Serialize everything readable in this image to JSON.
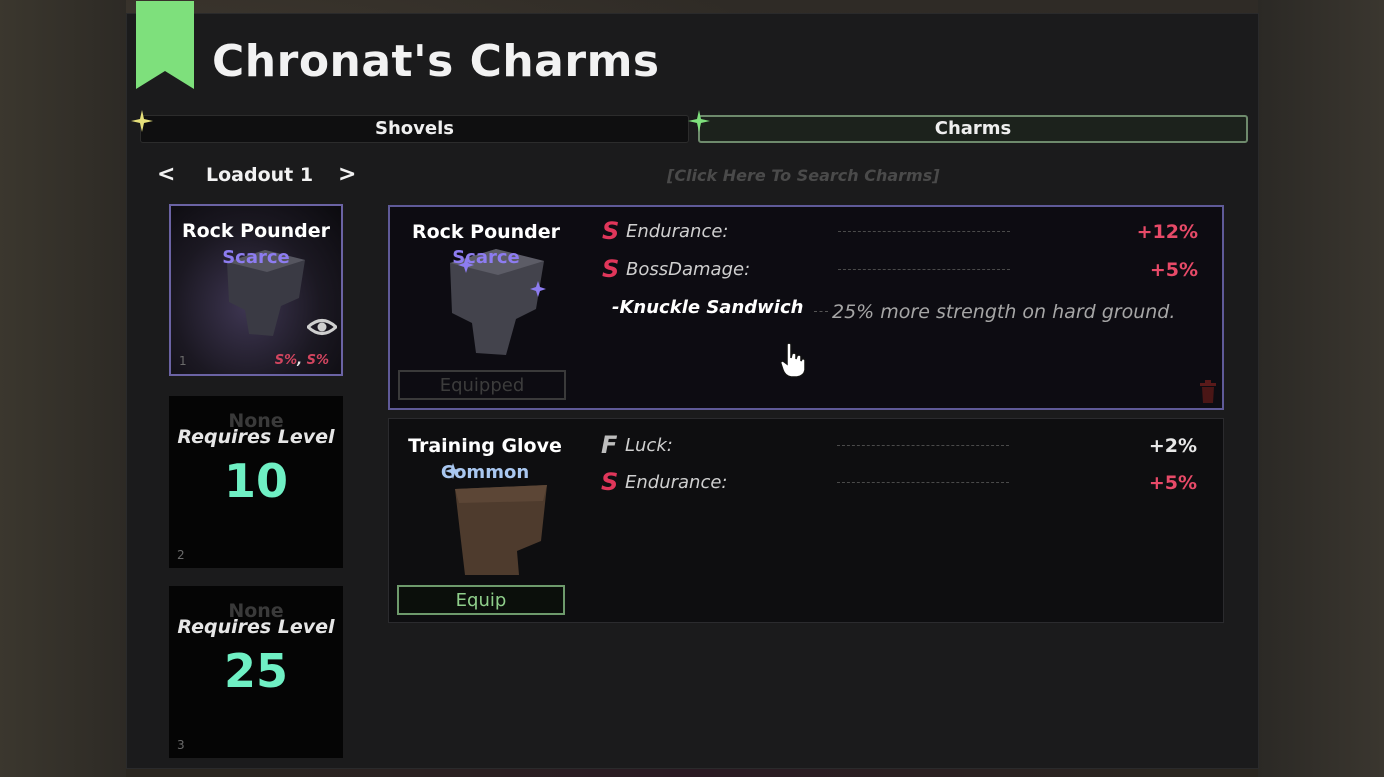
{
  "colors": {
    "panel": "#1b1b1c",
    "accent_green": "#7ee07c",
    "scarce": "#8d7cf0",
    "common": "#a9c7f0",
    "grade_s": "#e0365a",
    "level_text": "#6ff0c4"
  },
  "header": {
    "title": "Chronat's Charms",
    "ribbon_icon": "bookmark-ribbon"
  },
  "tabs": [
    {
      "label": "Shovels",
      "active": false
    },
    {
      "label": "Charms",
      "active": true
    }
  ],
  "loadout": {
    "prev": "<",
    "next": ">",
    "name": "Loadout 1"
  },
  "search": {
    "placeholder": "[Click Here To Search Charms]"
  },
  "slots": [
    {
      "number": "1",
      "title": "Rock Pounder",
      "rarity": "Scarce",
      "stats": [
        "S%",
        "S%"
      ],
      "stat_sep": ",",
      "icon": "eye-icon"
    },
    {
      "number": "2",
      "none": "None",
      "requires": "Requires Level",
      "level": "10"
    },
    {
      "number": "3",
      "none": "None",
      "requires": "Requires Level",
      "level": "25"
    }
  ],
  "charms": [
    {
      "name": "Rock Pounder",
      "rarity": "Scarce",
      "button": "Equipped",
      "stats": [
        {
          "grade": "S",
          "label": "Endurance:",
          "value": "+12%"
        },
        {
          "grade": "S",
          "label": "BossDamage:",
          "value": "+5%"
        }
      ],
      "ability": {
        "marker": "-",
        "name": "Knuckle Sandwich",
        "desc": "25% more strength on hard ground."
      }
    },
    {
      "name": "Training Glove",
      "rarity": "Common",
      "button": "Equip",
      "stats": [
        {
          "grade": "F",
          "label": "Luck:",
          "value": "+2%"
        },
        {
          "grade": "S",
          "label": "Endurance:",
          "value": "+5%"
        }
      ]
    }
  ]
}
